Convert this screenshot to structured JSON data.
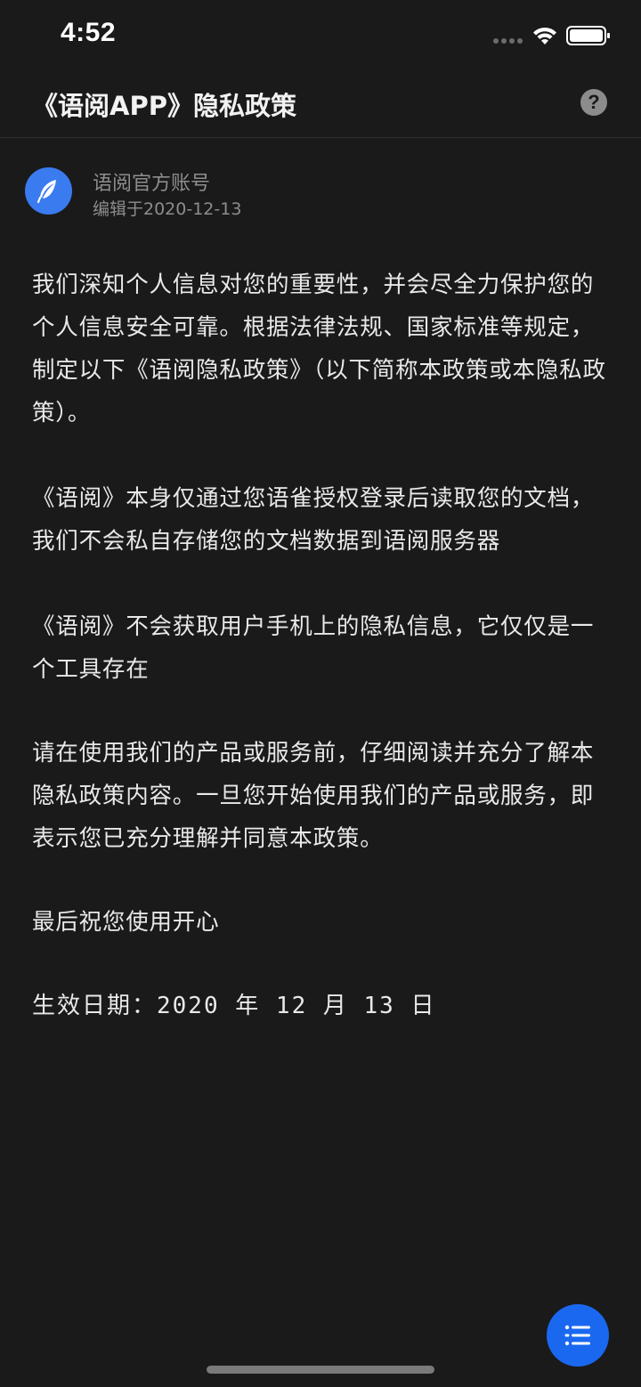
{
  "status_bar": {
    "time": "4:52"
  },
  "header": {
    "title": "《语阅APP》隐私政策",
    "help_label": "?"
  },
  "author": {
    "name": "语阅官方账号",
    "edited": "编辑于2020-12-13"
  },
  "content": {
    "paragraphs": [
      "我们深知个人信息对您的重要性，并会尽全力保护您的个人信息安全可靠。根据法律法规、国家标准等规定，制定以下《语阅隐私政策》（以下简称本政策或本隐私政策）。",
      "《语阅》本身仅通过您语雀授权登录后读取您的文档，我们不会私自存储您的文档数据到语阅服务器",
      "《语阅》不会获取用户手机上的隐私信息，它仅仅是一个工具存在",
      "请在使用我们的产品或服务前，仔细阅读并充分了解本隐私政策内容。一旦您开始使用我们的产品或服务，即表示您已充分理解并同意本政策。",
      "最后祝您使用开心"
    ],
    "effective_date": "生效日期：2020 年 12 月 13 日"
  },
  "icons": {
    "avatar": "feather-icon",
    "toc": "list-icon",
    "help": "question-icon"
  },
  "colors": {
    "background": "#1a1a1a",
    "accent": "#1a68f0",
    "avatar_bg": "#3a7bf0"
  }
}
